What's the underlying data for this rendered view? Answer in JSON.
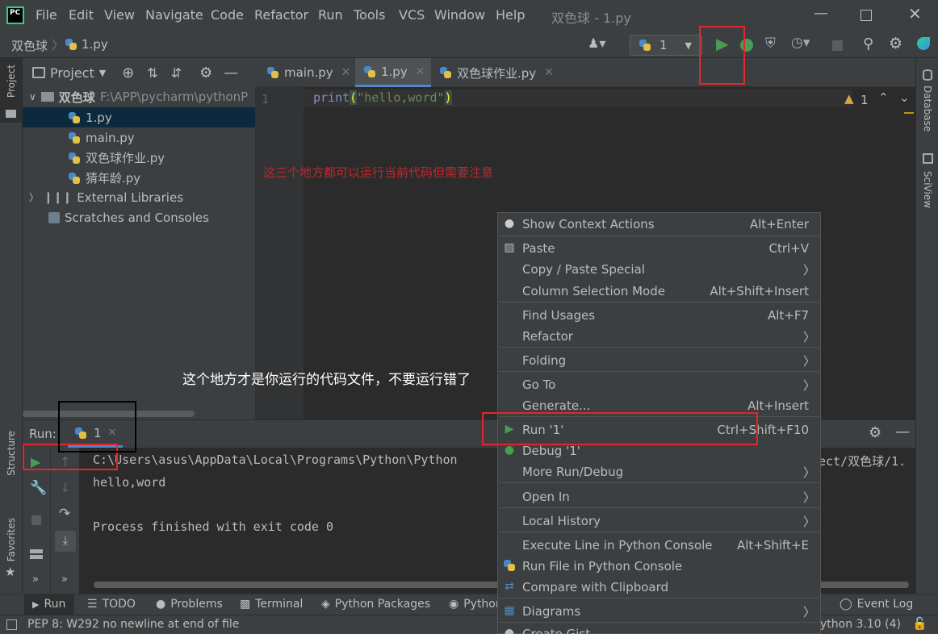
{
  "app": {
    "title": "双色球 - 1.py"
  },
  "menu": [
    "File",
    "Edit",
    "View",
    "Navigate",
    "Code",
    "Refactor",
    "Run",
    "Tools",
    "VCS",
    "Window",
    "Help"
  ],
  "nav": {
    "project": "双色球",
    "file": "1.py",
    "run_config": "1"
  },
  "project_panel": {
    "title": "Project",
    "root_name": "双色球",
    "root_path": "F:\\APP\\pycharm\\pythonP",
    "files": [
      "1.py",
      "main.py",
      "双色球作业.py",
      "猜年龄.py"
    ],
    "external": "External Libraries",
    "scratches": "Scratches and Consoles"
  },
  "editor": {
    "tabs": [
      "main.py",
      "1.py",
      "双色球作业.py"
    ],
    "line_number": "1",
    "code_func": "print",
    "code_open": "(",
    "code_str": "\"hello,word\"",
    "code_close": ")",
    "warnings": "1"
  },
  "annotations": {
    "red_note": "这三个地方都可以运行当前代码但需要注意",
    "white_note": "这个地方才是你运行的代码文件，不要运行错了"
  },
  "run_panel": {
    "label": "Run:",
    "tab": "1",
    "output": [
      "C:\\Users\\asus\\AppData\\Local\\Programs\\Python\\Python",
      "hello,word",
      "",
      "Process finished with exit code 0"
    ],
    "output_tail": "ect/双色球/1."
  },
  "context_menu": [
    {
      "label": "Show Context Actions",
      "shortcut": "Alt+Enter",
      "icon": "bulb-icon"
    },
    {
      "label": "Paste",
      "shortcut": "Ctrl+V",
      "icon": "clipboard-icon"
    },
    {
      "label": "Copy / Paste Special",
      "submenu": true
    },
    {
      "label": "Column Selection Mode",
      "shortcut": "Alt+Shift+Insert"
    },
    {
      "label": "Find Usages",
      "shortcut": "Alt+F7"
    },
    {
      "label": "Refactor",
      "submenu": true
    },
    {
      "label": "Folding",
      "submenu": true
    },
    {
      "label": "Go To",
      "submenu": true
    },
    {
      "label": "Generate...",
      "shortcut": "Alt+Insert"
    },
    {
      "label": "Run '1'",
      "shortcut": "Ctrl+Shift+F10",
      "icon": "run-icon"
    },
    {
      "label": "Debug '1'",
      "icon": "debug-icon"
    },
    {
      "label": "More Run/Debug",
      "submenu": true
    },
    {
      "label": "Open In",
      "submenu": true
    },
    {
      "label": "Local History",
      "submenu": true
    },
    {
      "label": "Execute Line in Python Console",
      "shortcut": "Alt+Shift+E"
    },
    {
      "label": "Run File in Python Console",
      "icon": "python-icon"
    },
    {
      "label": "Compare with Clipboard",
      "icon": "compare-icon"
    },
    {
      "label": "Diagrams",
      "submenu": true,
      "icon": "diagram-icon"
    },
    {
      "label": "Create Gist...",
      "icon": "github-icon"
    }
  ],
  "bottom_tabs": [
    "Run",
    "TODO",
    "Problems",
    "Terminal",
    "Python Packages",
    "Python",
    "Event Log"
  ],
  "side_tabs": {
    "left": [
      "Project",
      "Structure",
      "Favorites"
    ],
    "right": [
      "Database",
      "SciView"
    ]
  },
  "status": {
    "message": "PEP 8: W292 no newline at end of file",
    "interpreter": "ython 3.10 (4)"
  },
  "colors": {
    "bg": "#2b2b2b",
    "panel": "#3c3f41",
    "accent_red": "#e3262c",
    "run_green": "#499c54"
  }
}
